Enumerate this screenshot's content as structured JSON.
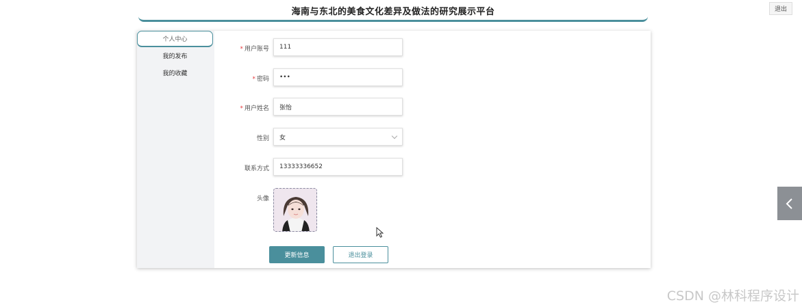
{
  "header": {
    "title": "海南与东北的美食文化差异及做法的研究展示平台",
    "logout_label": "退出"
  },
  "sidebar": {
    "items": [
      {
        "label": "个人中心",
        "active": true
      },
      {
        "label": "我的发布",
        "active": false
      },
      {
        "label": "我的收藏",
        "active": false
      }
    ]
  },
  "form": {
    "username": {
      "label": "用户账号",
      "value": "111",
      "required": true
    },
    "password": {
      "label": "密码",
      "value": "•••",
      "required": true
    },
    "realname": {
      "label": "用户姓名",
      "value": "张怡",
      "required": true
    },
    "gender": {
      "label": "性别",
      "value": "女"
    },
    "phone": {
      "label": "联系方式",
      "value": "13333336652"
    },
    "avatar": {
      "label": "头像"
    }
  },
  "buttons": {
    "update": "更新信息",
    "logout": "退出登录"
  },
  "watermark": "CSDN @林科程序设计",
  "colors": {
    "accent": "#4a8f9c",
    "required": "#e4393c",
    "toggle": "#8c9095"
  }
}
